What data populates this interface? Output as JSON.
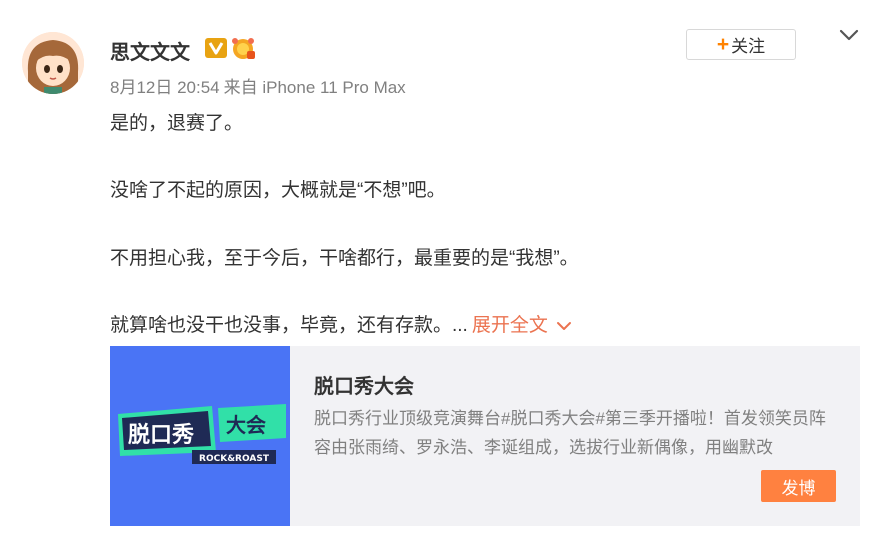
{
  "user": {
    "name": "思文文文",
    "avatar_icon": "cartoon-girl-avatar-icon",
    "verified_icon": "v-verified-badge-icon",
    "medal_icon": "gold-medal-badge-icon"
  },
  "follow_button": {
    "plus": "+",
    "label": "关注"
  },
  "post_meta": {
    "date": "8月12日 20:54",
    "source": "来自 iPhone 11 Pro Max"
  },
  "post": {
    "paragraphs": [
      "是的，退赛了。",
      "没啥了不起的原因，大概就是“不想”吧。",
      "不用担心我，至于今后，干啥都行，最重要的是“我想”。",
      "就算啥也没干也没事，毕竟，还有存款。..."
    ],
    "expand_label": "展开全文"
  },
  "card": {
    "logo_text_1": "脱口秀",
    "logo_text_2": "大会",
    "logo_subtitle": "ROCK&ROAST",
    "title": "脱口秀大会",
    "description": "脱口秀行业顶级竞演舞台#脱口秀大会#第三季开播啦！首发领笑员阵容由张雨绮、罗永浩、李诞组成，选拔行业新偶像，用幽默改",
    "button_label": "发博"
  },
  "colors": {
    "accent_orange": "#ff8140",
    "link_orange": "#eb7350",
    "meta_gray": "#808080",
    "card_bg": "#f2f2f5",
    "thumb_blue": "#4a74f5",
    "logo_green": "#31e0a8"
  }
}
